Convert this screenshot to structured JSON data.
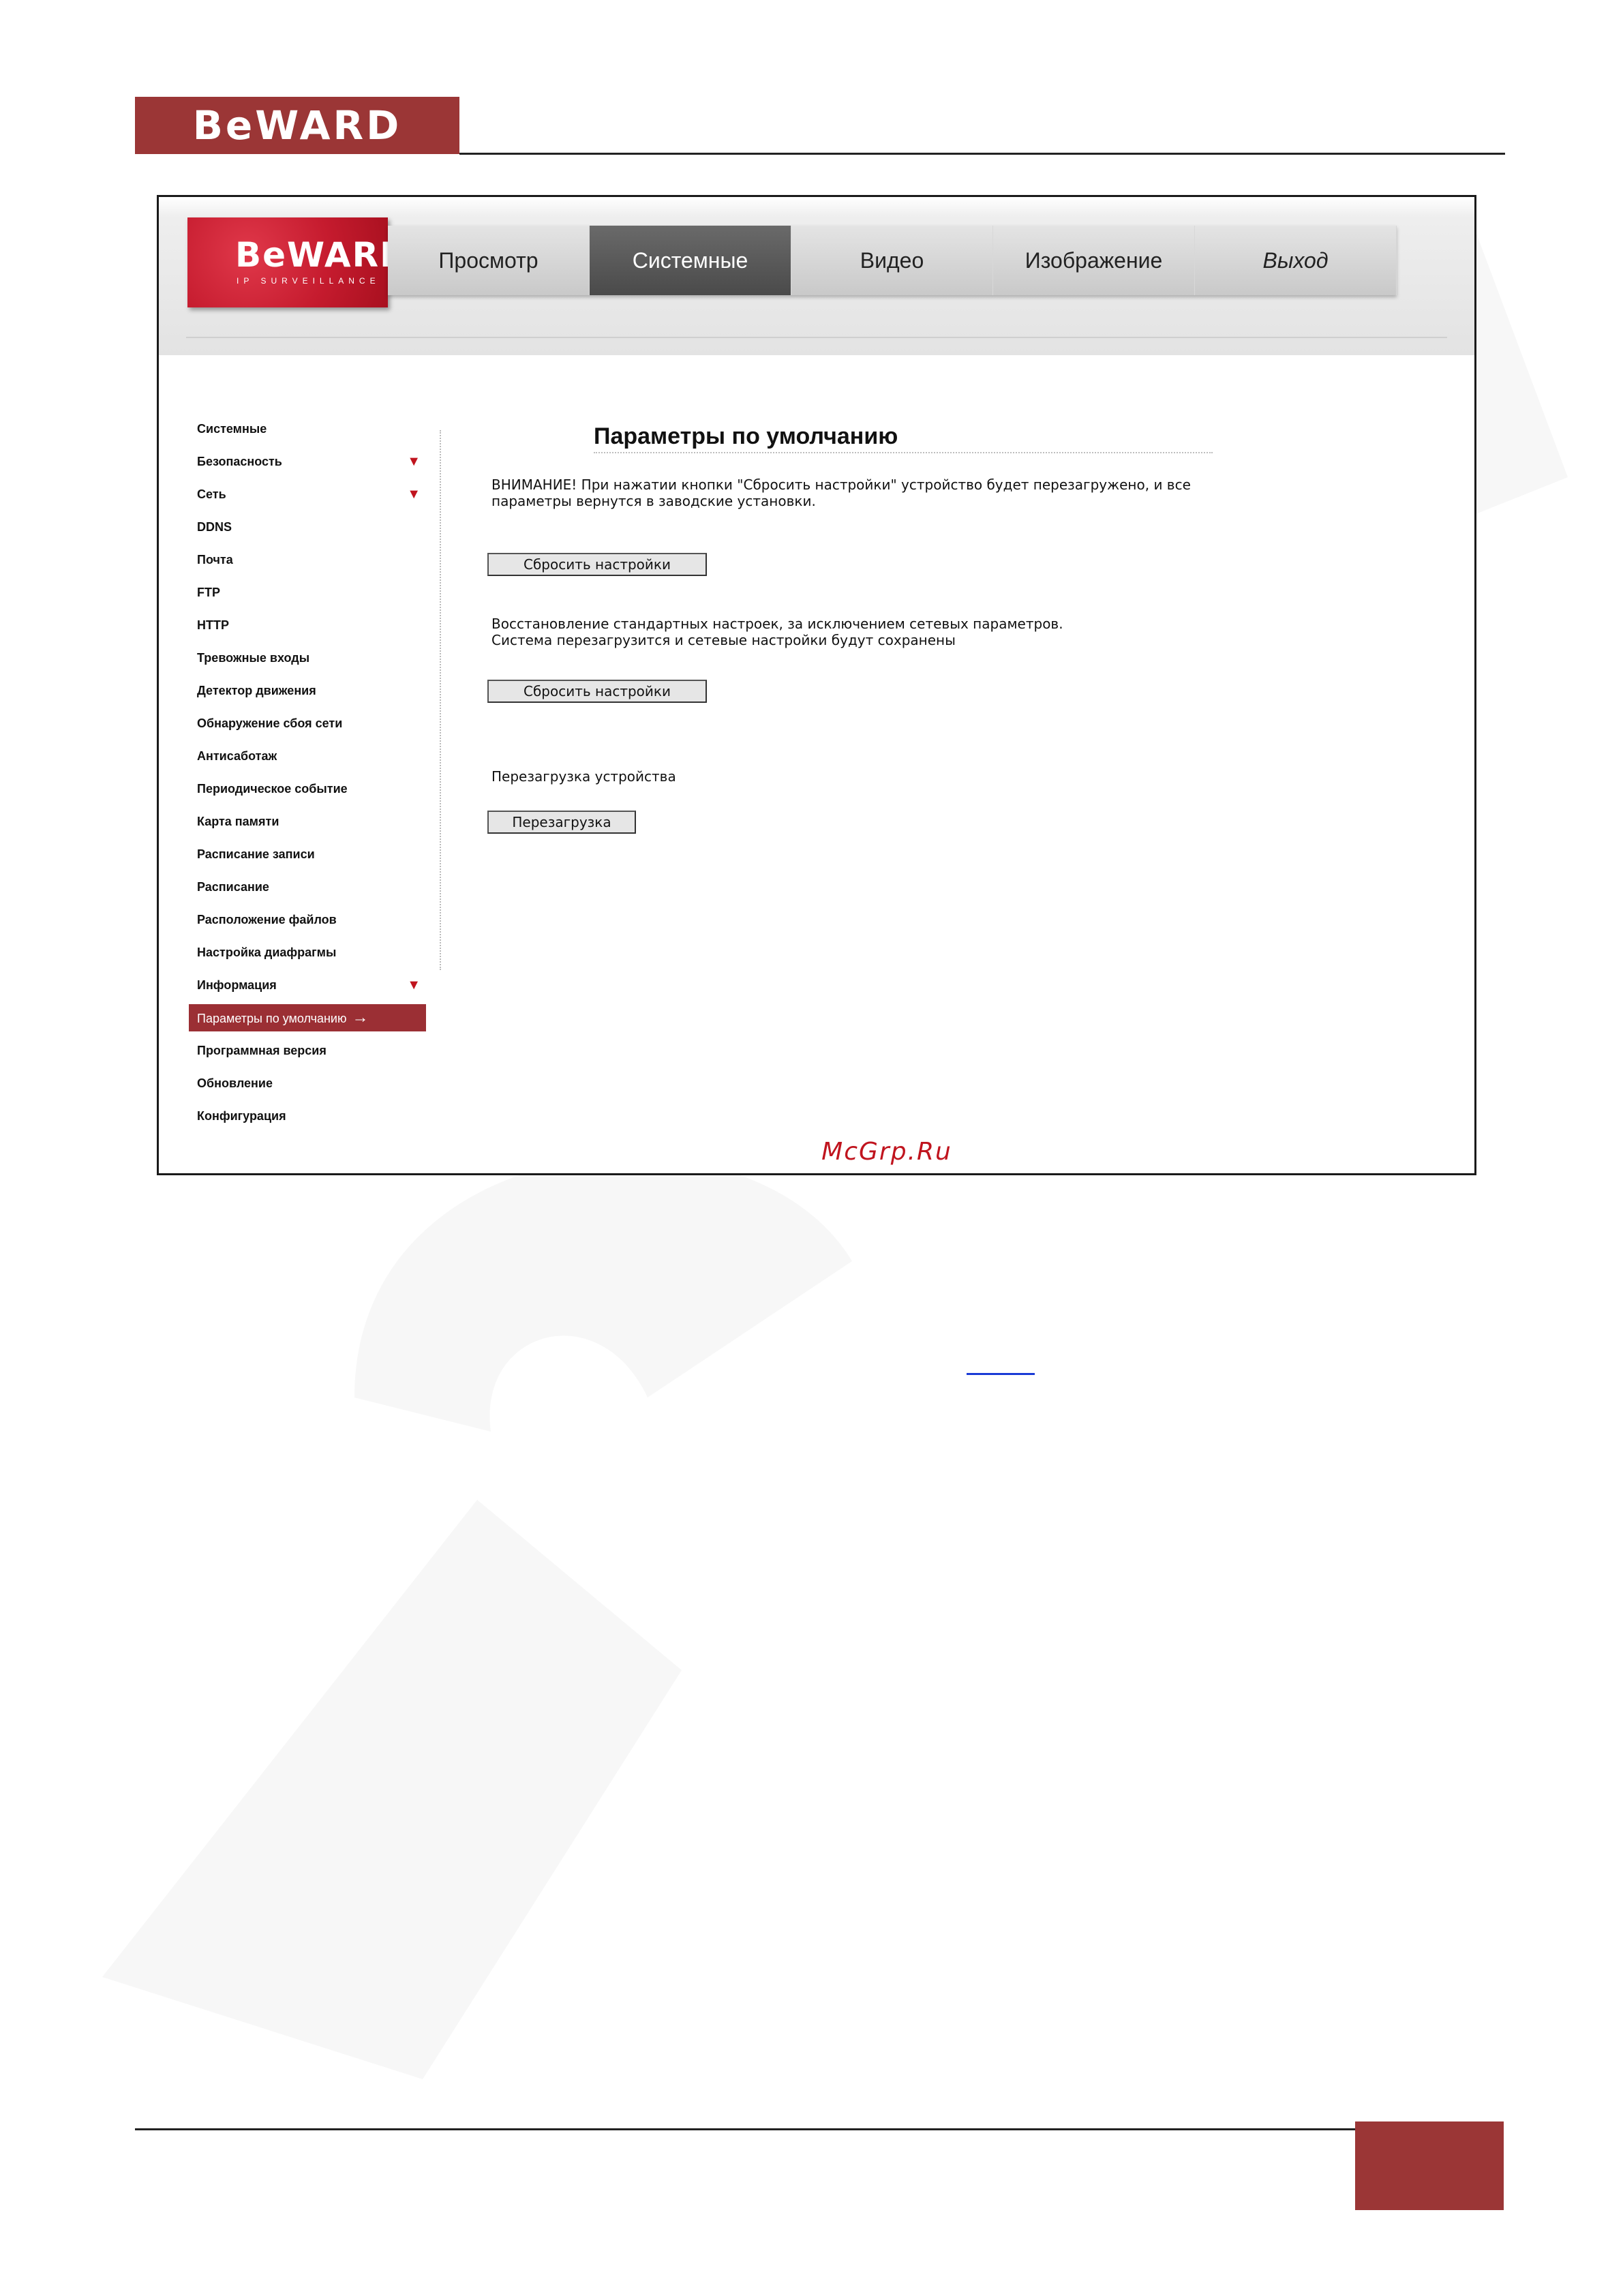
{
  "document": {
    "header_logo": "BeWARD"
  },
  "app": {
    "logo_name": "BeWARD",
    "logo_tagline": "IP SURVEILLANCE",
    "nav_tabs": [
      {
        "label": "Просмотр",
        "active": false
      },
      {
        "label": "Системные",
        "active": true
      },
      {
        "label": "Видео",
        "active": false
      },
      {
        "label": "Изображение",
        "active": false
      },
      {
        "label": "Выход",
        "active": false
      }
    ],
    "sidebar": {
      "items": [
        {
          "label": "Системные",
          "expandable": false
        },
        {
          "label": "Безопасность",
          "expandable": true
        },
        {
          "label": "Сеть",
          "expandable": true
        },
        {
          "label": "DDNS",
          "expandable": false
        },
        {
          "label": "Почта",
          "expandable": false
        },
        {
          "label": "FTP",
          "expandable": false
        },
        {
          "label": "HTTP",
          "expandable": false
        },
        {
          "label": "Тревожные входы",
          "expandable": false
        },
        {
          "label": "Детектор движения",
          "expandable": false
        },
        {
          "label": "Обнаружение сбоя сети",
          "expandable": false
        },
        {
          "label": "Антисаботаж",
          "expandable": false
        },
        {
          "label": "Периодическое событие",
          "expandable": false
        },
        {
          "label": "Карта памяти",
          "expandable": false
        },
        {
          "label": "Расписание записи",
          "expandable": false
        },
        {
          "label": "Расписание",
          "expandable": false
        },
        {
          "label": "Расположение файлов",
          "expandable": false
        },
        {
          "label": "Настройка диафрагмы",
          "expandable": false
        },
        {
          "label": "Информация",
          "expandable": true
        },
        {
          "label": "Параметры по умолчанию",
          "expandable": false,
          "current": true
        },
        {
          "label": "Программная версия",
          "expandable": false
        },
        {
          "label": "Обновление",
          "expandable": false
        },
        {
          "label": "Конфигурация",
          "expandable": false
        }
      ],
      "expand_icon": "triangle-down-icon",
      "current_icon": "arrow-right-icon"
    },
    "content": {
      "title": "Параметры по умолчанию",
      "warning_line1": "ВНИМАНИЕ! При нажатии кнопки \"Сбросить настройки\" устройство будет перезагружено, и все",
      "warning_line2": "параметры вернутся в заводские установки.",
      "reset_all_button": "Сбросить настройки",
      "partial_line1": "Восстановление стандартных настроек, за исключением сетевых параметров.",
      "partial_line2": "Система перезагрузится и сетевые настройки будут сохранены",
      "reset_partial_button": "Сбросить настройки",
      "reboot_label": "Перезагрузка устройства",
      "reboot_button": "Перезагрузка"
    },
    "watermark_text": "McGrp.Ru"
  },
  "colors": {
    "brand_dark_red": "#9b3636",
    "logo_red": "#c51b2e",
    "accent_red": "#c0141e",
    "active_tab": "#555555",
    "link_blue": "#1a3bd6"
  }
}
